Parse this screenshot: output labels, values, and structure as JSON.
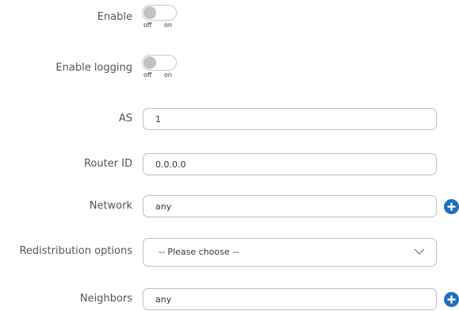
{
  "fields": {
    "enable": {
      "label": "Enable",
      "off": "off",
      "on": "on",
      "state": "off"
    },
    "enable_logging": {
      "label": "Enable logging",
      "off": "off",
      "on": "on",
      "state": "off"
    },
    "as": {
      "label": "AS",
      "value": "1"
    },
    "router_id": {
      "label": "Router ID",
      "value": "0.0.0.0"
    },
    "network": {
      "label": "Network",
      "value": "any"
    },
    "redistribution": {
      "label": "Redistribution options",
      "selected": "-- Please choose --"
    },
    "neighbors": {
      "label": "Neighbors",
      "value": "any"
    }
  },
  "icons": {
    "add": "plus-circle-icon",
    "dropdown": "chevron-down-icon"
  },
  "colors": {
    "accent": "#1e6fbf",
    "border": "#bdbdbd",
    "toggle_knob_off": "#c2c2c2"
  }
}
